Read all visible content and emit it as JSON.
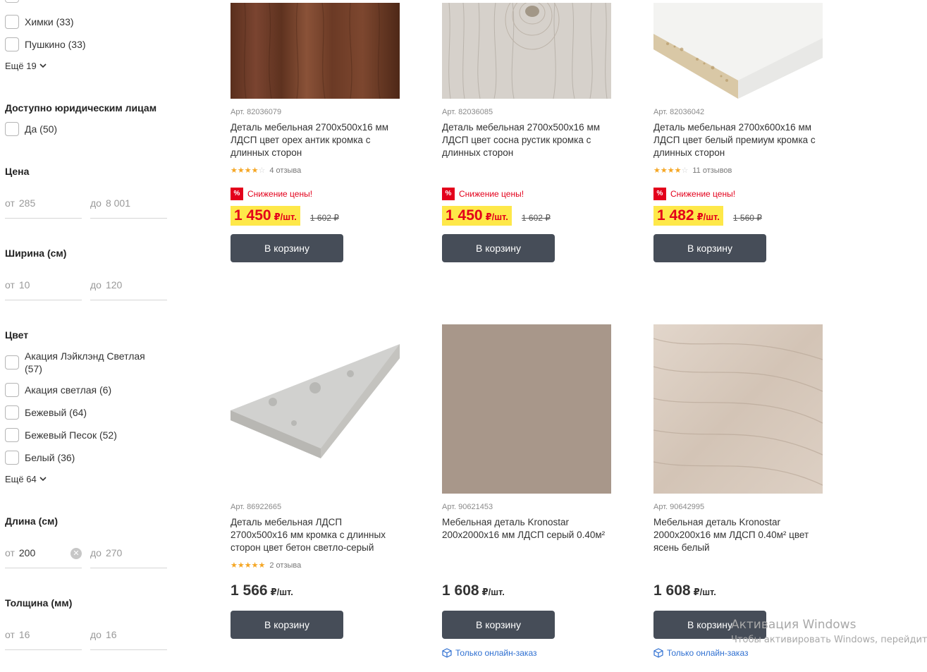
{
  "sidebar": {
    "city_options": [
      {
        "label": "Химки (33)"
      },
      {
        "label": "Пушкино (33)"
      }
    ],
    "city_more": "Ещё 19",
    "legal": {
      "title": "Доступно юридическим лицам",
      "option": "Да (50)"
    },
    "price": {
      "title": "Цена",
      "from_label": "от",
      "from_placeholder": "285",
      "to_label": "до",
      "to_placeholder": "8 001"
    },
    "width": {
      "title": "Ширина (см)",
      "from_label": "от",
      "from_placeholder": "10",
      "to_label": "до",
      "to_placeholder": "120"
    },
    "color": {
      "title": "Цвет",
      "options": [
        {
          "label": "Акация Лэйклэнд Светлая (57)"
        },
        {
          "label": "Акация светлая (6)"
        },
        {
          "label": "Бежевый (64)"
        },
        {
          "label": "Бежевый Песок (52)"
        },
        {
          "label": "Белый (36)"
        }
      ],
      "more": "Ещё 64"
    },
    "length": {
      "title": "Длина (см)",
      "from_label": "от",
      "from_value": "200",
      "to_label": "до",
      "to_placeholder": "270"
    },
    "thickness": {
      "title": "Толщина (мм)",
      "from_label": "от",
      "from_placeholder": "16",
      "to_label": "до",
      "to_placeholder": "16"
    }
  },
  "products": [
    {
      "art": "Арт. 82036079",
      "title": "Деталь мебельная 2700x500x16 мм ЛДСП цвет орех антик кромка с длинных сторон",
      "rating": 3.5,
      "reviews": "4 отзыва",
      "promo": "Снижение цены!",
      "price": "1 450",
      "unit": "₽/шт.",
      "old_price": "1 602 ₽",
      "button": "В корзину",
      "image": "walnut-wood-texture"
    },
    {
      "art": "Арт. 82036085",
      "title": "Деталь мебельная 2700x500x16 мм ЛДСП цвет сосна рустик кромка с длинных сторон",
      "promo": "Снижение цены!",
      "price": "1 450",
      "unit": "₽/шт.",
      "old_price": "1 602 ₽",
      "button": "В корзину",
      "image": "rustic-pine-texture"
    },
    {
      "art": "Арт. 82036042",
      "title": "Деталь мебельная 2700x600x16 мм ЛДСП цвет белый премиум кромка с длинных сторон",
      "rating": 3.5,
      "reviews": "11 отзывов",
      "promo": "Снижение цены!",
      "price": "1 482",
      "unit": "₽/шт.",
      "old_price": "1 560 ₽",
      "button": "В корзину",
      "image": "white-board-edge"
    },
    {
      "art": "Арт. 86922665",
      "title": "Деталь мебельная ЛДСП 2700x500x16 мм кромка с длинных сторон цвет бетон светло-серый",
      "rating": 5,
      "reviews": "2 отзыва",
      "price": "1 566",
      "unit": "₽/шт.",
      "button": "В корзину",
      "image": "concrete-grey-board"
    },
    {
      "art": "Арт. 90621453",
      "title": "Мебельная деталь Kronostar 200x2000x16 мм ЛДСП серый 0.40м²",
      "price": "1 608",
      "unit": "₽/шт.",
      "button": "В корзину",
      "online": "Только онлайн-заказ",
      "image": "grey-beige-swatch"
    },
    {
      "art": "Арт. 90642995",
      "title": "Мебельная деталь Kronostar 2000x200x16 мм ЛДСП 0.40м² цвет ясень белый",
      "price": "1 608",
      "unit": "₽/шт.",
      "button": "В корзину",
      "online": "Только онлайн-заказ",
      "image": "white-ash-texture"
    }
  ],
  "colors": {
    "accent_red": "#e3001b",
    "price_highlight": "#fee849",
    "button": "#464d58",
    "link": "#2e6fd1",
    "star": "#f5a623"
  },
  "watermark": {
    "line1": "Активация Windows",
    "line2": "Чтобы активировать Windows, перейдите"
  }
}
